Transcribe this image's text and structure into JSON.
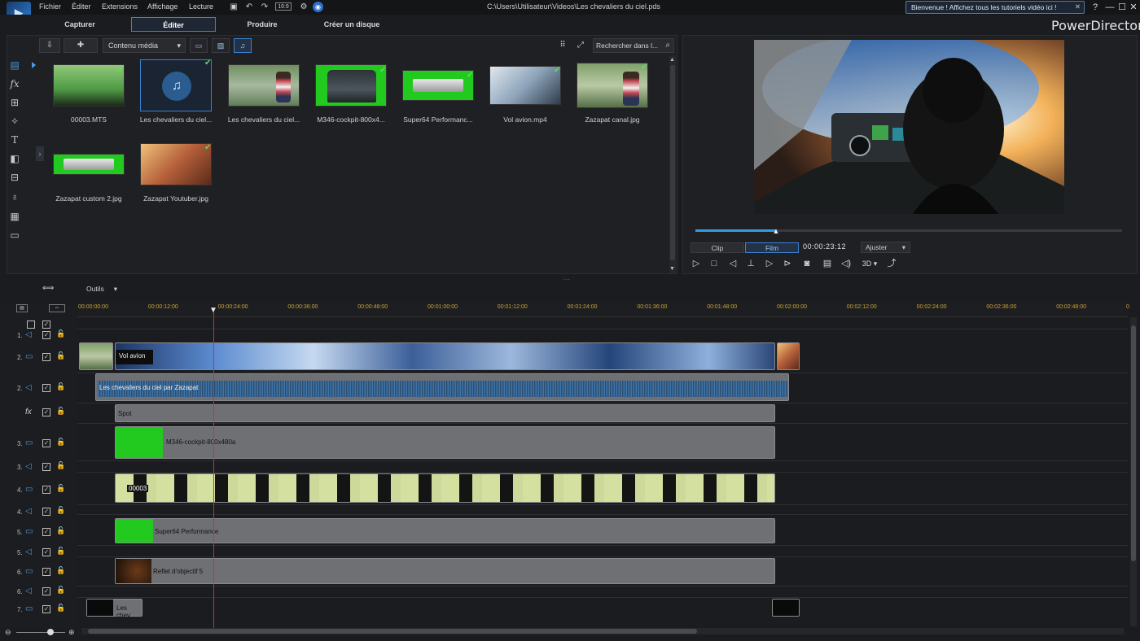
{
  "menubar": {
    "items": [
      "Fichier",
      "Éditer",
      "Extensions",
      "Affichage",
      "Lecture"
    ],
    "aspect": "16:9",
    "file_path": "C:\\Users\\Utilisateur\\Videos\\Les chevaliers du ciel.pds",
    "tip": "Bienvenue ! Affichez tous les tutoriels vidéo ici !",
    "help": "?",
    "minimize": "—",
    "maximize": "☐",
    "close": "✕"
  },
  "modes": {
    "capture": "Capturer",
    "edit": "Éditer",
    "produce": "Produire",
    "disc": "Créer un disque",
    "brand": "PowerDirector"
  },
  "library": {
    "filter": "Contenu média",
    "search_placeholder": "Rechercher dans l...",
    "items": [
      {
        "label": "00003.MTS"
      },
      {
        "label": "Les chevaliers du ciel..."
      },
      {
        "label": "Les chevaliers du ciel..."
      },
      {
        "label": "M346-cockpit-800x4..."
      },
      {
        "label": "Super64 Performanc..."
      },
      {
        "label": "Vol avion.mp4"
      },
      {
        "label": "Zazapat canal.jpg"
      },
      {
        "label": "Zazapat custom 2.jpg"
      },
      {
        "label": "Zazapat Youtuber.jpg"
      }
    ]
  },
  "preview": {
    "clip_label": "Clip",
    "film_label": "Film",
    "timecode": "00:00:23:12",
    "fit": "Ajuster",
    "mode3d": "3D",
    "progress": 0.19
  },
  "timeline": {
    "tools_label": "Outils",
    "ruler_ticks": [
      "00:00:00:00",
      "00:00:12:00",
      "00:00:24:00",
      "00:00:36:00",
      "00:00:48:00",
      "00:01:00:00",
      "00:01:12:00",
      "00:01:24:00",
      "00:01:36:00",
      "00:01:48:00",
      "00:02:00:00",
      "00:02:12:00",
      "00:02:24:00",
      "00:02:36:00",
      "00:02:48:00",
      "0"
    ],
    "tracks": [
      {
        "num": "1."
      },
      {
        "num": "2."
      },
      {
        "num": "2."
      },
      {
        "num": ""
      },
      {
        "num": "3."
      },
      {
        "num": "3."
      },
      {
        "num": "4."
      },
      {
        "num": "4."
      },
      {
        "num": "5."
      },
      {
        "num": "5."
      },
      {
        "num": "6."
      },
      {
        "num": "6."
      },
      {
        "num": "7."
      }
    ],
    "clips": {
      "vol_avion": "Vol avion",
      "audio": "Les chevaliers du ciel par Zazapat",
      "fx": "Spot",
      "cockpit": "M346-cockpit-800x480a",
      "mts": "00003",
      "super64": "Super64 Performance",
      "reflet": "Reflet d'objectif 5",
      "title": "Les chev"
    }
  },
  "colors": {
    "accent": "#3b82d0",
    "playhead": "#c0392b",
    "ruler": "#c9a23a",
    "chroma": "#22c91f"
  }
}
